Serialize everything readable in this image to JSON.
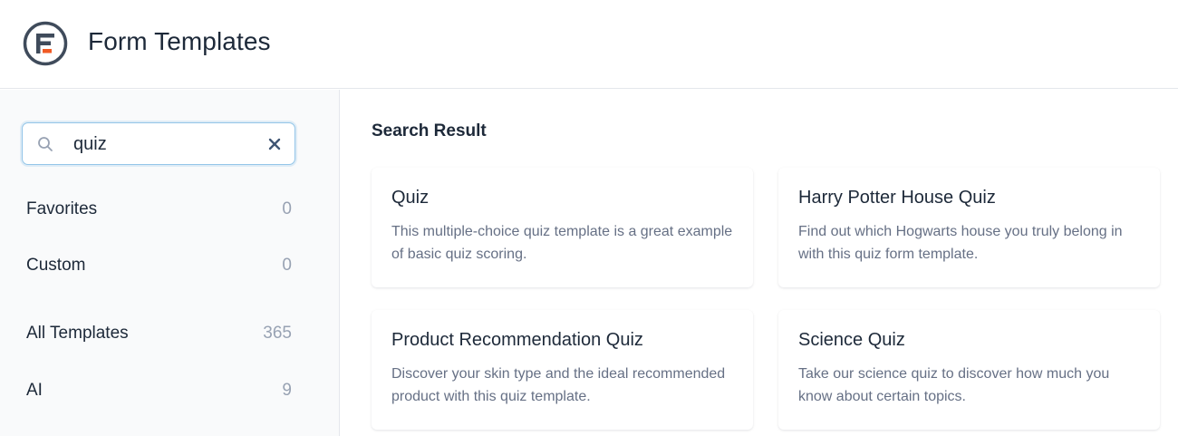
{
  "header": {
    "title": "Form Templates",
    "logo_icon": "formidable-logo-icon",
    "brand_color": "#3f4b5b",
    "accent_color": "#f05a24"
  },
  "sidebar": {
    "search": {
      "value": "quiz",
      "placeholder": "Search templates",
      "icon": "search-icon",
      "clear_icon": "close-icon"
    },
    "items": [
      {
        "label": "Favorites",
        "count": "0"
      },
      {
        "label": "Custom",
        "count": "0"
      },
      {
        "label": "All Templates",
        "count": "365"
      },
      {
        "label": "AI",
        "count": "9"
      }
    ]
  },
  "main": {
    "section_title": "Search Result",
    "cards": [
      {
        "title": "Quiz",
        "description": "This multiple-choice quiz template is a great example of basic quiz scoring."
      },
      {
        "title": "Harry Potter House Quiz",
        "description": "Find out which Hogwarts house you truly belong in with this quiz form template."
      },
      {
        "title": "Product Recommendation Quiz",
        "description": "Discover your skin type and the ideal recommended product with this quiz template."
      },
      {
        "title": "Science Quiz",
        "description": "Take our science quiz to discover how much you know about certain topics."
      }
    ]
  }
}
